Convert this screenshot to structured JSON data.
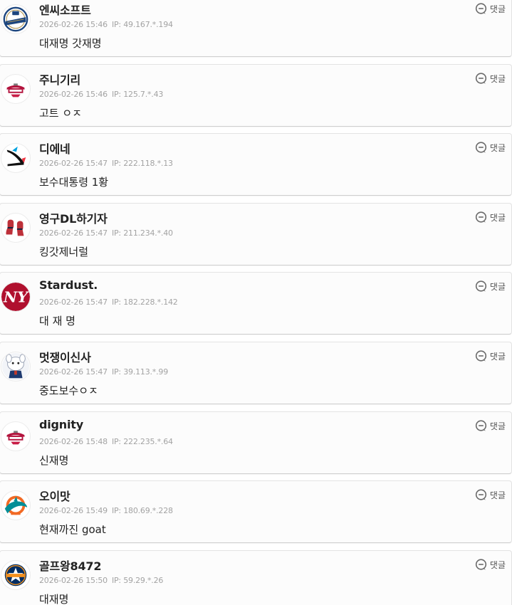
{
  "comments": [
    {
      "avatar": "nc-dinos-logo",
      "nickname": "엔씨소프트",
      "datetime": "2026-02-26 15:46",
      "ip": "IP: 49.167.*.194",
      "text": "대재명 갓재명",
      "reply_label": "댓글",
      "reply_icon": "speech-bubble-icon"
    },
    {
      "avatar": "lg-twins-logo",
      "nickname": "주니기리",
      "datetime": "2026-02-26 15:46",
      "ip": "IP: 125.7.*.43",
      "text": "고트 ㅇㅈ",
      "reply_label": "댓글",
      "reply_icon": "speech-bubble-icon"
    },
    {
      "avatar": "miami-marlins-logo",
      "nickname": "디에네",
      "datetime": "2026-02-26 15:47",
      "ip": "IP: 222.118.*.13",
      "text": "보수대통령 1황",
      "reply_label": "댓글",
      "reply_icon": "speech-bubble-icon"
    },
    {
      "avatar": "red-sox-logo",
      "nickname": "영구DL하기자",
      "datetime": "2026-02-26 15:47",
      "ip": "IP: 211.234.*.40",
      "text": "킹갓제너럴",
      "reply_label": "댓글",
      "reply_icon": "speech-bubble-icon"
    },
    {
      "avatar": "yankees-logo",
      "nickname": "Stardust.",
      "datetime": "2026-02-26 15:47",
      "ip": "IP: 182.228.*.142",
      "text": "대 재 명",
      "reply_label": "댓글",
      "reply_icon": "speech-bubble-icon"
    },
    {
      "avatar": "mascot-avatar",
      "nickname": "멋쟁이신사",
      "datetime": "2026-02-26 15:47",
      "ip": "IP: 39.113.*.99",
      "text": "중도보수ㅇㅈ",
      "reply_label": "댓글",
      "reply_icon": "speech-bubble-icon"
    },
    {
      "avatar": "lg-twins-logo",
      "nickname": "dignity",
      "datetime": "2026-02-26 15:48",
      "ip": "IP: 222.235.*.64",
      "text": "신재명",
      "reply_label": "댓글",
      "reply_icon": "speech-bubble-icon"
    },
    {
      "avatar": "miami-dolphins-logo",
      "nickname": "오이맛",
      "datetime": "2026-02-26 15:49",
      "ip": "IP: 180.69.*.228",
      "text": "현재까진 goat",
      "reply_label": "댓글",
      "reply_icon": "speech-bubble-icon"
    },
    {
      "avatar": "houston-astros-logo",
      "nickname": "골프왕8472",
      "datetime": "2026-02-26 15:50",
      "ip": "IP: 59.29.*.26",
      "text": "대재명",
      "reply_label": "댓글",
      "reply_icon": "speech-bubble-icon"
    }
  ]
}
